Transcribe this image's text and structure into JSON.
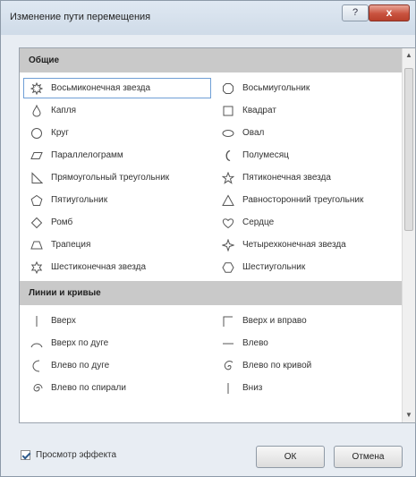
{
  "window": {
    "title": "Изменение пути перемещения",
    "help_label": "?",
    "close_label": "x"
  },
  "sections": [
    {
      "header": "Общие",
      "items": [
        {
          "label": "Восьмиконечная звезда",
          "icon": "star8-icon",
          "selected": true
        },
        {
          "label": "Восьмиугольник",
          "icon": "octagon-icon"
        },
        {
          "label": "Капля",
          "icon": "teardrop-icon"
        },
        {
          "label": "Квадрат",
          "icon": "square-icon"
        },
        {
          "label": "Круг",
          "icon": "circle-icon"
        },
        {
          "label": "Овал",
          "icon": "oval-icon"
        },
        {
          "label": "Параллелограмм",
          "icon": "parallelogram-icon"
        },
        {
          "label": "Полумесяц",
          "icon": "crescent-icon"
        },
        {
          "label": "Прямоугольный треугольник",
          "icon": "right-triangle-icon"
        },
        {
          "label": "Пятиконечная звезда",
          "icon": "star5-icon"
        },
        {
          "label": "Пятиугольник",
          "icon": "pentagon-icon"
        },
        {
          "label": "Равносторонний треугольник",
          "icon": "triangle-icon"
        },
        {
          "label": "Ромб",
          "icon": "diamond-icon"
        },
        {
          "label": "Сердце",
          "icon": "heart-icon"
        },
        {
          "label": "Трапеция",
          "icon": "trapezoid-icon"
        },
        {
          "label": "Четырехконечная звезда",
          "icon": "star4-icon"
        },
        {
          "label": "Шестиконечная звезда",
          "icon": "star6-icon"
        },
        {
          "label": "Шестиугольник",
          "icon": "hexagon-icon"
        }
      ]
    },
    {
      "header": "Линии и кривые",
      "items": [
        {
          "label": "Вверх",
          "icon": "line-up-icon"
        },
        {
          "label": "Вверх и вправо",
          "icon": "up-right-icon"
        },
        {
          "label": "Вверх по дуге",
          "icon": "arc-up-icon"
        },
        {
          "label": "Влево",
          "icon": "line-left-icon"
        },
        {
          "label": "Влево по дуге",
          "icon": "arc-left-icon"
        },
        {
          "label": "Влево по кривой",
          "icon": "curve-left-icon"
        },
        {
          "label": "Влево по спирали",
          "icon": "spiral-left-icon"
        },
        {
          "label": "Вниз",
          "icon": "line-down-icon"
        }
      ]
    }
  ],
  "footer": {
    "preview_label": "Просмотр эффекта",
    "preview_checked": true,
    "ok_label": "ОК",
    "cancel_label": "Отмена"
  }
}
